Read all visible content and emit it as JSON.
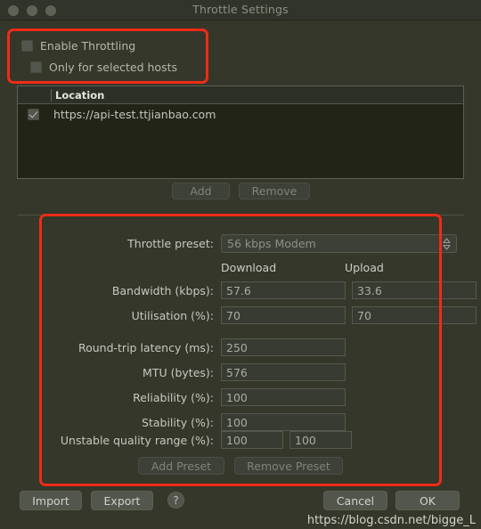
{
  "window": {
    "title": "Throttle Settings",
    "controls": [
      "close-button",
      "minimize-button",
      "maximize-button"
    ]
  },
  "throttling": {
    "enable_label": "Enable Throttling",
    "enable_checked": false,
    "only_selected_label": "Only for selected hosts",
    "only_selected_checked": false
  },
  "hosts": {
    "column_header": "Location",
    "rows": [
      {
        "checked": true,
        "location": "https://api-test.ttjianbao.com"
      }
    ],
    "add_label": "Add",
    "remove_label": "Remove"
  },
  "preset": {
    "label": "Throttle preset:",
    "value": "56 kbps Modem",
    "chevron_icon": "chevron-updown-icon"
  },
  "columns": {
    "download": "Download",
    "upload": "Upload"
  },
  "fields": [
    {
      "label": "Bandwidth (kbps):",
      "download": "57.6",
      "upload": "33.6",
      "dual": true
    },
    {
      "label": "Utilisation (%):",
      "download": "70",
      "upload": "70",
      "dual": true
    },
    {
      "label": "Round-trip latency (ms):",
      "download": "250",
      "upload": "",
      "dual": false
    },
    {
      "label": "MTU (bytes):",
      "download": "576",
      "upload": "",
      "dual": false
    },
    {
      "label": "Reliability (%):",
      "download": "100",
      "upload": "",
      "dual": false
    },
    {
      "label": "Stability (%):",
      "download": "100",
      "upload": "",
      "dual": false
    }
  ],
  "unstable": {
    "label": "Unstable quality range (%):",
    "min": "100",
    "max": "100"
  },
  "preset_buttons": {
    "add_label": "Add Preset",
    "remove_label": "Remove Preset"
  },
  "footer": {
    "import_label": "Import",
    "export_label": "Export",
    "help_label": "?",
    "cancel_label": "Cancel",
    "ok_label": "OK"
  },
  "watermark": "https://blog.csdn.net/bigge_L",
  "colors": {
    "window_bg": "#343729",
    "highlight_red": "#f02b18",
    "field_bg": "#383b31",
    "button_bg": "#53564c"
  }
}
